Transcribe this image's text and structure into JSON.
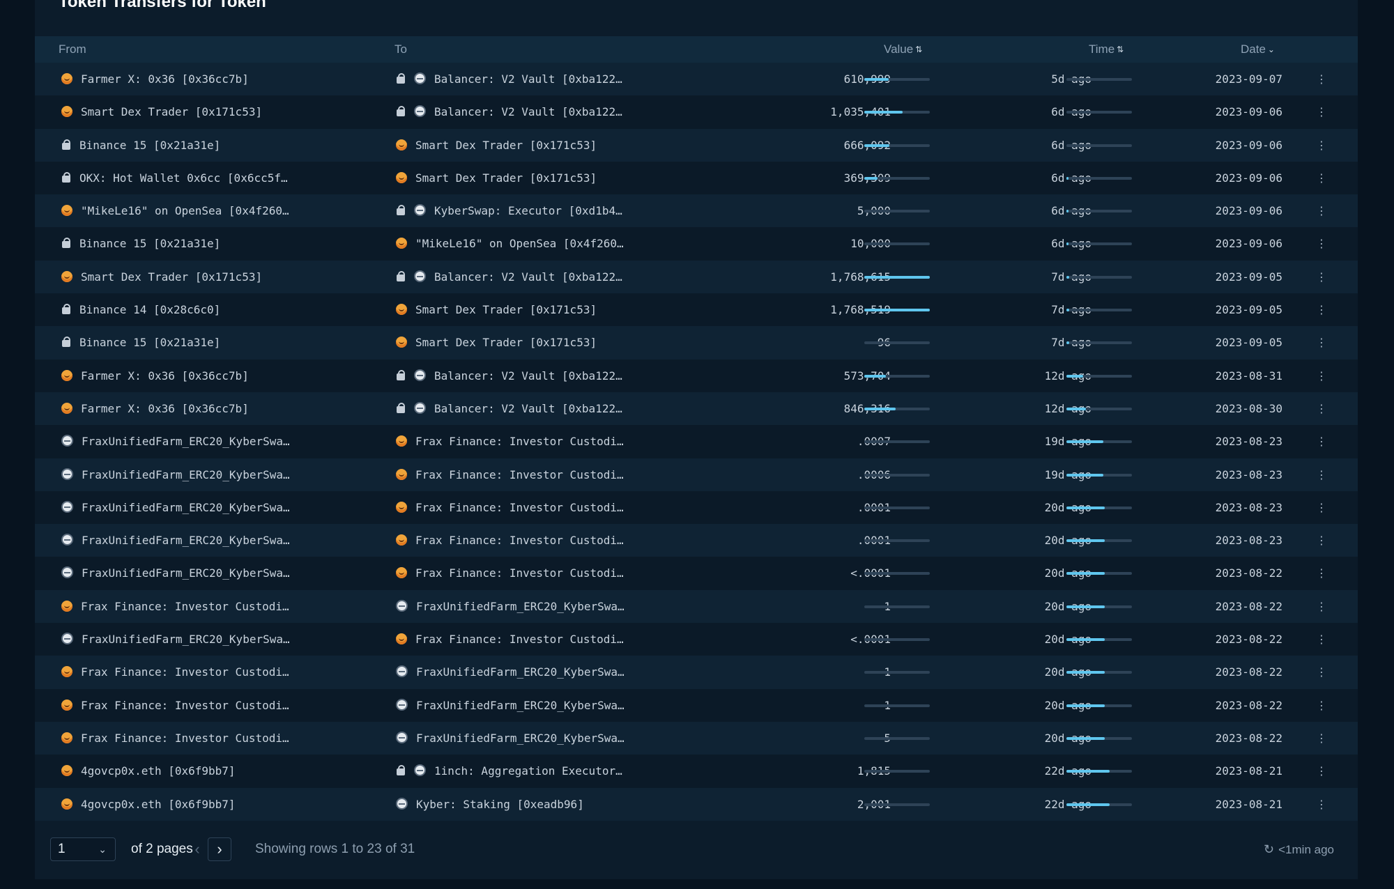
{
  "panel": {
    "title": "Token Transfers for Token"
  },
  "columns": {
    "from": "From",
    "to": "To",
    "value": "Value",
    "time": "Time",
    "date": "Date",
    "value_sort_icon": "sort-both-icon",
    "time_sort_icon": "sort-both-icon",
    "date_sort_icon": "sort-desc-icon"
  },
  "rows": [
    {
      "from_icon": "entity-face-icon",
      "from": "Farmer X: 0x36 [0x36cc7b]",
      "to_icons": [
        "contract-icon",
        "robot-icon"
      ],
      "to": "Balancer: V2 Vault [0xba122…",
      "value": "610,999",
      "value_pct": 37,
      "time": "5d ago",
      "time_pct": 0,
      "date": "2023-09-07"
    },
    {
      "from_icon": "entity-face-icon",
      "from": "Smart Dex Trader [0x171c53]",
      "to_icons": [
        "contract-icon",
        "robot-icon"
      ],
      "to": "Balancer: V2 Vault [0xba122…",
      "value": "1,035,401",
      "value_pct": 58,
      "time": "6d ago",
      "time_pct": 0,
      "date": "2023-09-06"
    },
    {
      "from_icon": "contract-icon",
      "from": "Binance 15 [0x21a31e]",
      "to_icons": [
        "entity-face-icon"
      ],
      "to": "Smart Dex Trader [0x171c53]",
      "value": "666,092",
      "value_pct": 38,
      "time": "6d ago",
      "time_pct": 0,
      "date": "2023-09-06"
    },
    {
      "from_icon": "contract-icon",
      "from": "OKX: Hot Wallet 0x6cc [0x6cc5f…",
      "to_icons": [
        "entity-face-icon"
      ],
      "to": "Smart Dex Trader [0x171c53]",
      "value": "369,309",
      "value_pct": 20,
      "time": "6d ago",
      "time_pct": 3,
      "date": "2023-09-06"
    },
    {
      "from_icon": "entity-face-icon",
      "from": "\"MikeLe16\" on OpenSea [0x4f260…",
      "to_icons": [
        "contract-icon",
        "robot-icon"
      ],
      "to": "KyberSwap: Executor [0xd1b4…",
      "value": "5,000",
      "value_pct": 0,
      "time": "6d ago",
      "time_pct": 3,
      "date": "2023-09-06"
    },
    {
      "from_icon": "contract-icon",
      "from": "Binance 15 [0x21a31e]",
      "to_icons": [
        "entity-face-icon"
      ],
      "to": "\"MikeLe16\" on OpenSea [0x4f260…",
      "value": "10,000",
      "value_pct": 0,
      "time": "6d ago",
      "time_pct": 3,
      "date": "2023-09-06"
    },
    {
      "from_icon": "entity-face-icon",
      "from": "Smart Dex Trader [0x171c53]",
      "to_icons": [
        "contract-icon",
        "robot-icon"
      ],
      "to": "Balancer: V2 Vault [0xba122…",
      "value": "1,768,615",
      "value_pct": 100,
      "time": "7d ago",
      "time_pct": 4,
      "date": "2023-09-05"
    },
    {
      "from_icon": "contract-icon",
      "from": "Binance 14 [0x28c6c0]",
      "to_icons": [
        "entity-face-icon"
      ],
      "to": "Smart Dex Trader [0x171c53]",
      "value": "1,768,519",
      "value_pct": 100,
      "time": "7d ago",
      "time_pct": 4,
      "date": "2023-09-05"
    },
    {
      "from_icon": "contract-icon",
      "from": "Binance 15 [0x21a31e]",
      "to_icons": [
        "entity-face-icon"
      ],
      "to": "Smart Dex Trader [0x171c53]",
      "value": "96",
      "value_pct": 0,
      "time": "7d ago",
      "time_pct": 4,
      "date": "2023-09-05"
    },
    {
      "from_icon": "entity-face-icon",
      "from": "Farmer X: 0x36 [0x36cc7b]",
      "to_icons": [
        "contract-icon",
        "robot-icon"
      ],
      "to": "Balancer: V2 Vault [0xba122…",
      "value": "573,704",
      "value_pct": 33,
      "time": "12d ago",
      "time_pct": 26,
      "date": "2023-08-31"
    },
    {
      "from_icon": "entity-face-icon",
      "from": "Farmer X: 0x36 [0x36cc7b]",
      "to_icons": [
        "contract-icon",
        "robot-icon"
      ],
      "to": "Balancer: V2 Vault [0xba122…",
      "value": "846,316",
      "value_pct": 48,
      "time": "12d ago",
      "time_pct": 30,
      "date": "2023-08-30"
    },
    {
      "from_icon": "robot-icon",
      "from": "FraxUnifiedFarm_ERC20_KyberSwa…",
      "to_icons": [
        "entity-face-icon"
      ],
      "to": "Frax Finance: Investor Custodi…",
      "value": ".0007",
      "value_pct": 0,
      "time": "19d ago",
      "time_pct": 56,
      "date": "2023-08-23"
    },
    {
      "from_icon": "robot-icon",
      "from": "FraxUnifiedFarm_ERC20_KyberSwa…",
      "to_icons": [
        "entity-face-icon"
      ],
      "to": "Frax Finance: Investor Custodi…",
      "value": ".0006",
      "value_pct": 0,
      "time": "19d ago",
      "time_pct": 56,
      "date": "2023-08-23"
    },
    {
      "from_icon": "robot-icon",
      "from": "FraxUnifiedFarm_ERC20_KyberSwa…",
      "to_icons": [
        "entity-face-icon"
      ],
      "to": "Frax Finance: Investor Custodi…",
      "value": ".0001",
      "value_pct": 0,
      "time": "20d ago",
      "time_pct": 58,
      "date": "2023-08-23"
    },
    {
      "from_icon": "robot-icon",
      "from": "FraxUnifiedFarm_ERC20_KyberSwa…",
      "to_icons": [
        "entity-face-icon"
      ],
      "to": "Frax Finance: Investor Custodi…",
      "value": ".0001",
      "value_pct": 0,
      "time": "20d ago",
      "time_pct": 58,
      "date": "2023-08-23"
    },
    {
      "from_icon": "robot-icon",
      "from": "FraxUnifiedFarm_ERC20_KyberSwa…",
      "to_icons": [
        "entity-face-icon"
      ],
      "to": "Frax Finance: Investor Custodi…",
      "value": "<.0001",
      "value_pct": 0,
      "time": "20d ago",
      "time_pct": 58,
      "date": "2023-08-22"
    },
    {
      "from_icon": "entity-face-icon",
      "from": "Frax Finance: Investor Custodi…",
      "to_icons": [
        "robot-icon"
      ],
      "to": "FraxUnifiedFarm_ERC20_KyberSwa…",
      "value": "1",
      "value_pct": 0,
      "time": "20d ago",
      "time_pct": 58,
      "date": "2023-08-22"
    },
    {
      "from_icon": "robot-icon",
      "from": "FraxUnifiedFarm_ERC20_KyberSwa…",
      "to_icons": [
        "entity-face-icon"
      ],
      "to": "Frax Finance: Investor Custodi…",
      "value": "<.0001",
      "value_pct": 0,
      "time": "20d ago",
      "time_pct": 58,
      "date": "2023-08-22"
    },
    {
      "from_icon": "entity-face-icon",
      "from": "Frax Finance: Investor Custodi…",
      "to_icons": [
        "robot-icon"
      ],
      "to": "FraxUnifiedFarm_ERC20_KyberSwa…",
      "value": "1",
      "value_pct": 0,
      "time": "20d ago",
      "time_pct": 58,
      "date": "2023-08-22"
    },
    {
      "from_icon": "entity-face-icon",
      "from": "Frax Finance: Investor Custodi…",
      "to_icons": [
        "robot-icon"
      ],
      "to": "FraxUnifiedFarm_ERC20_KyberSwa…",
      "value": "1",
      "value_pct": 0,
      "time": "20d ago",
      "time_pct": 58,
      "date": "2023-08-22"
    },
    {
      "from_icon": "entity-face-icon",
      "from": "Frax Finance: Investor Custodi…",
      "to_icons": [
        "robot-icon"
      ],
      "to": "FraxUnifiedFarm_ERC20_KyberSwa…",
      "value": "5",
      "value_pct": 0,
      "time": "20d ago",
      "time_pct": 58,
      "date": "2023-08-22"
    },
    {
      "from_icon": "entity-face-icon",
      "from": "4govcp0x.eth [0x6f9bb7]",
      "to_icons": [
        "contract-icon",
        "robot-icon"
      ],
      "to": "1inch: Aggregation Executor…",
      "value": "1,815",
      "value_pct": 0,
      "time": "22d ago",
      "time_pct": 66,
      "date": "2023-08-21"
    },
    {
      "from_icon": "entity-face-icon",
      "from": "4govcp0x.eth [0x6f9bb7]",
      "to_icons": [
        "robot-icon"
      ],
      "to": "Kyber: Staking [0xeadb96]",
      "value": "2,001",
      "value_pct": 0,
      "time": "22d ago",
      "time_pct": 66,
      "date": "2023-08-21"
    }
  ],
  "pagination": {
    "current_page": "1",
    "of_pages": "of 2 pages",
    "showing": "Showing rows 1 to 23 of 31",
    "refresh_label": "<1min ago"
  },
  "colors": {
    "background": "#07131f",
    "panel": "#0c1c2b",
    "accent_bar": "#5fc6ee",
    "entity_icon": "#f0a43a"
  }
}
